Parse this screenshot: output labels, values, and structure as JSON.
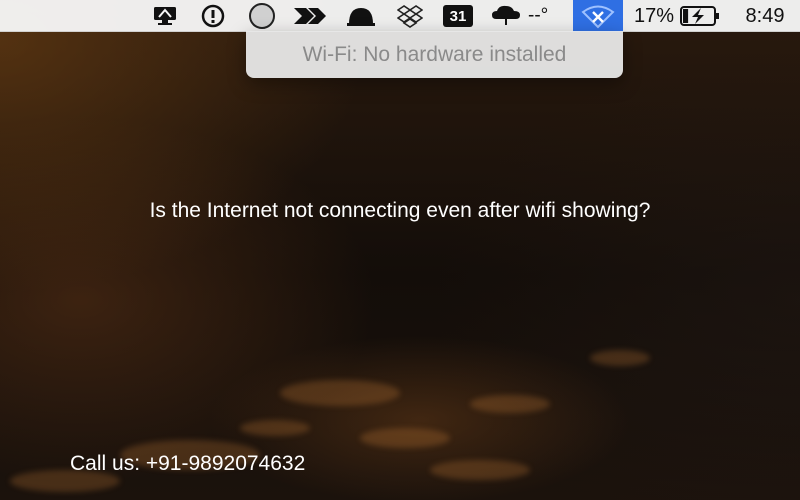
{
  "menubar": {
    "icons": [
      "display-sync-icon",
      "info-circle-icon",
      "empty-circle-icon",
      "double-arrow-icon",
      "bell-icon",
      "dropbox-icon",
      "calendar-icon",
      "weather-cloud-icon",
      "wifi-icon"
    ],
    "calendar_day": "31",
    "temperature": "--°",
    "battery_percent": "17%",
    "battery_level": 0.17,
    "clock": "8:49",
    "selected_color": "#2f6fe3"
  },
  "wifi_menu": {
    "status": "Wi-Fi: No hardware installed"
  },
  "content": {
    "headline": "Is the Internet not connecting even after wifi showing?",
    "contact": "Call us: +91-9892074632"
  }
}
